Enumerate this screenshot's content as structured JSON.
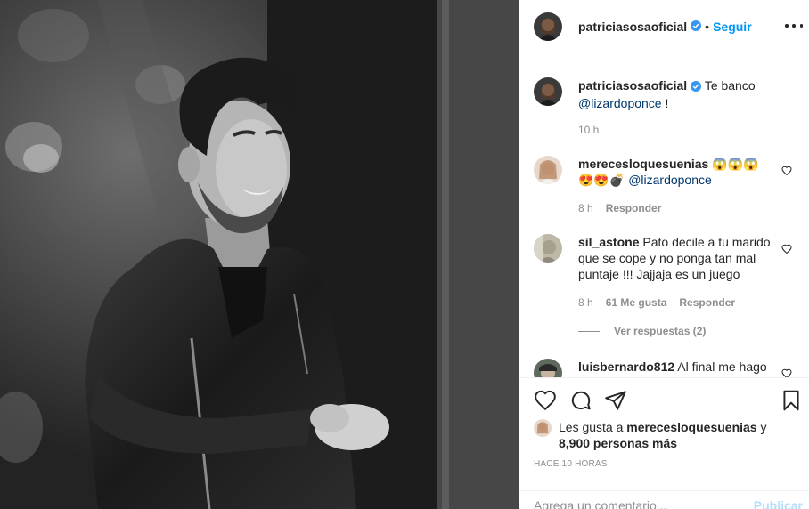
{
  "post": {
    "image_description": "",
    "username": "patriciasosaoficial",
    "follow_label": "Seguir",
    "separator": "•"
  },
  "caption": {
    "username": "patriciasosaoficial",
    "text": "Te banco",
    "mention": "@lizardoponce",
    "trailing": " !",
    "time": "10 h"
  },
  "comments": [
    {
      "username": "merecesloquesuenias",
      "text": "😱😱😱",
      "text2": "😍😍💣",
      "mention": "@lizardoponce",
      "time": "8 h",
      "reply_label": "Responder"
    },
    {
      "username": "sil_astone",
      "text": "Pato decile a tu marido que se cope y no ponga tan mal puntaje !!! Jajjaja es un juego",
      "time": "8 h",
      "likes": "61 Me gusta",
      "reply_label": "Responder",
      "view_replies": "Ver respuestas (2)"
    },
    {
      "username": "luisbernardo812",
      "text": "Al final me hago"
    }
  ],
  "likes": {
    "prefix": "Les gusta a",
    "user": "merecesloquesuenias",
    "middle": "y",
    "count": "8,900 personas más"
  },
  "timestamp": "HACE 10 HORAS",
  "add_comment": {
    "placeholder": "Agrega un comentario...",
    "publish_label": "Publicar"
  },
  "colors": {
    "link": "#0095f6",
    "mention": "#00376b",
    "muted": "#8e8e8e",
    "publish_disabled": "#b2dffc"
  }
}
